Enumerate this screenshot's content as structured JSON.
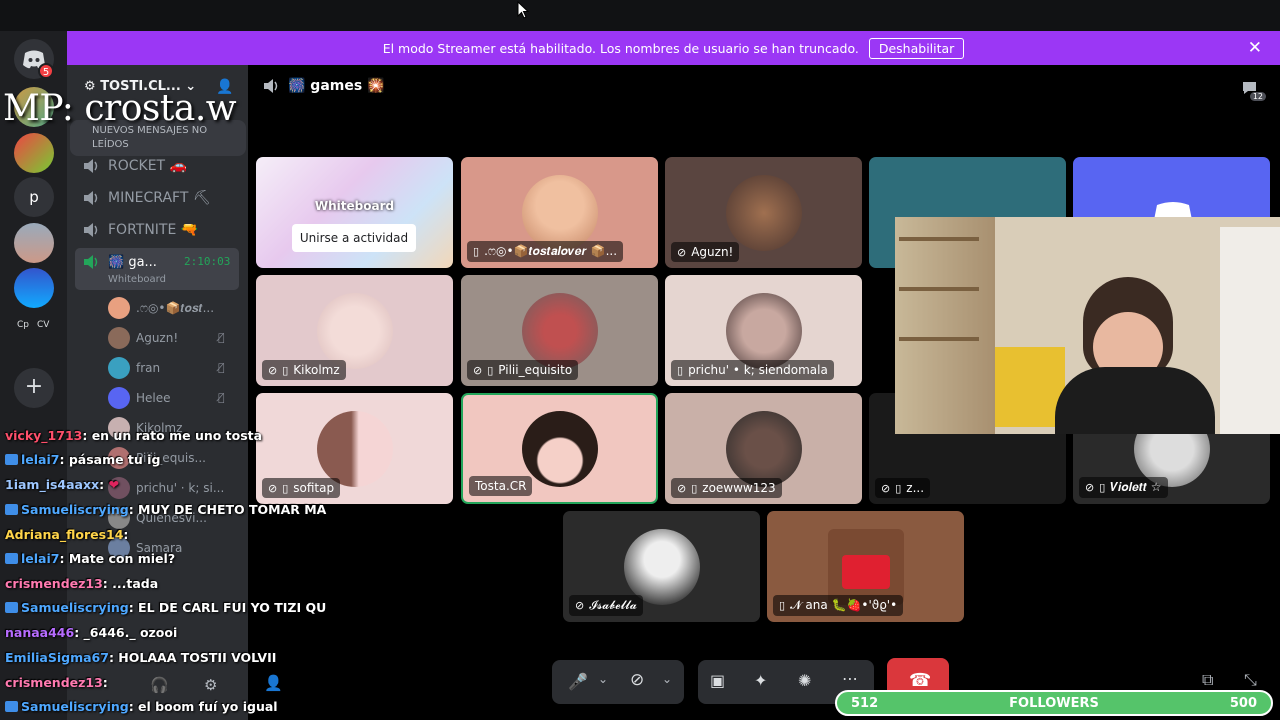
{
  "banner": {
    "text": "El modo Streamer está habilitado. Los nombres de usuario se han truncado.",
    "button": "Deshabilitar",
    "close_icon": "close-icon"
  },
  "rail": {
    "home_badge": "5",
    "labels": [
      "p",
      "Cp",
      "CV"
    ]
  },
  "overlay": {
    "mp_text": "MP: crosta.w"
  },
  "sidebar": {
    "server_name": "TOSTI.CL...",
    "unread_banner": "NUEVOS MENSAJES NO LEÍDOS",
    "channels": [
      {
        "label": "ROCKET 🚗"
      },
      {
        "label": "MINECRAFT ⛏"
      },
      {
        "label": "FORTNITE 🔫"
      }
    ],
    "active_channel": {
      "label": "🎆 ga...",
      "time": "2:10:03",
      "activity": "Whiteboard"
    },
    "members": [
      {
        "name": ".ෆ◎•📦𝒕𝒐𝒔𝒕..."
      },
      {
        "name": "Aguzn!"
      },
      {
        "name": "fran"
      },
      {
        "name": "Helee"
      },
      {
        "name": "Kikolmz"
      },
      {
        "name": "Pilii_equis..."
      },
      {
        "name": "prichu'  ·  k; si..."
      },
      {
        "name": "Quienesvi..."
      },
      {
        "name": "Samara"
      }
    ]
  },
  "main": {
    "channel_title": "🎆 games 🎇",
    "header_count": "12",
    "whiteboard": {
      "title": "Whiteboard",
      "join": "Unirse a actividad"
    },
    "tiles": [
      {
        "label": ".ෆ◎•📦𝒕𝒐𝒔𝒕𝒂𝒍𝒐𝒗𝒆𝒓 📦..."
      },
      {
        "label": "Aguzn!"
      },
      {
        "label": "Kikolmz"
      },
      {
        "label": "Pilii_equisito"
      },
      {
        "label": "prichu'  •  k; siendomala"
      },
      {
        "label": "sofitap"
      },
      {
        "label": "Tosta.CR"
      },
      {
        "label": "zoewww123"
      },
      {
        "label": "z..."
      },
      {
        "label": "𝑽𝒊𝒐𝒍𝒆𝒕𝒕 ☆"
      },
      {
        "label": "𝓘𝓼𝓪𝓫𝓮𝓵𝓵𝓪"
      },
      {
        "label": "𝓝 ana 🐛🍓•'ϑϱ'•"
      }
    ]
  },
  "chat": [
    {
      "user": "vicky_1713",
      "msg": ": en un rato me uno tosta",
      "color": "#ff4f6b"
    },
    {
      "user": "lelai7",
      "msg": ": pásame tu ig",
      "color": "#4fa8ff"
    },
    {
      "user": "1iam_is4aaxx",
      "msg": ":",
      "color": "#9ec7ff"
    },
    {
      "user": "Samueliscrying",
      "msg": ": MUY DE CHETO TOMAR MA",
      "color": "#4fa8ff"
    },
    {
      "user": "Adriana_flores14",
      "msg": ":",
      "color": "#ffd54a"
    },
    {
      "user": "lelai7",
      "msg": ": Mate con miel?",
      "color": "#4fa8ff"
    },
    {
      "user": "crismendez13",
      "msg": ": ...tada",
      "color": "#ff7ab0"
    },
    {
      "user": "Samueliscrying",
      "msg": ": EL DE CARL FUI YO TIZI QU",
      "color": "#4fa8ff"
    },
    {
      "user": "nanaa446",
      "msg": ": _6446._ ozooi",
      "color": "#b76cff"
    },
    {
      "user": "EmiliaSigma67",
      "msg": ": HOLAAA TOSTII VOLVII",
      "color": "#4fa8ff"
    },
    {
      "user": "crismendez13",
      "msg": ":",
      "color": "#ff7ab0"
    },
    {
      "user": "Samueliscrying",
      "msg": ": el boom fuí yo igual",
      "color": "#4fa8ff"
    }
  ],
  "followers": {
    "current": "512",
    "label": "FOLLOWERS",
    "goal": "500",
    "progress": 1.0
  }
}
